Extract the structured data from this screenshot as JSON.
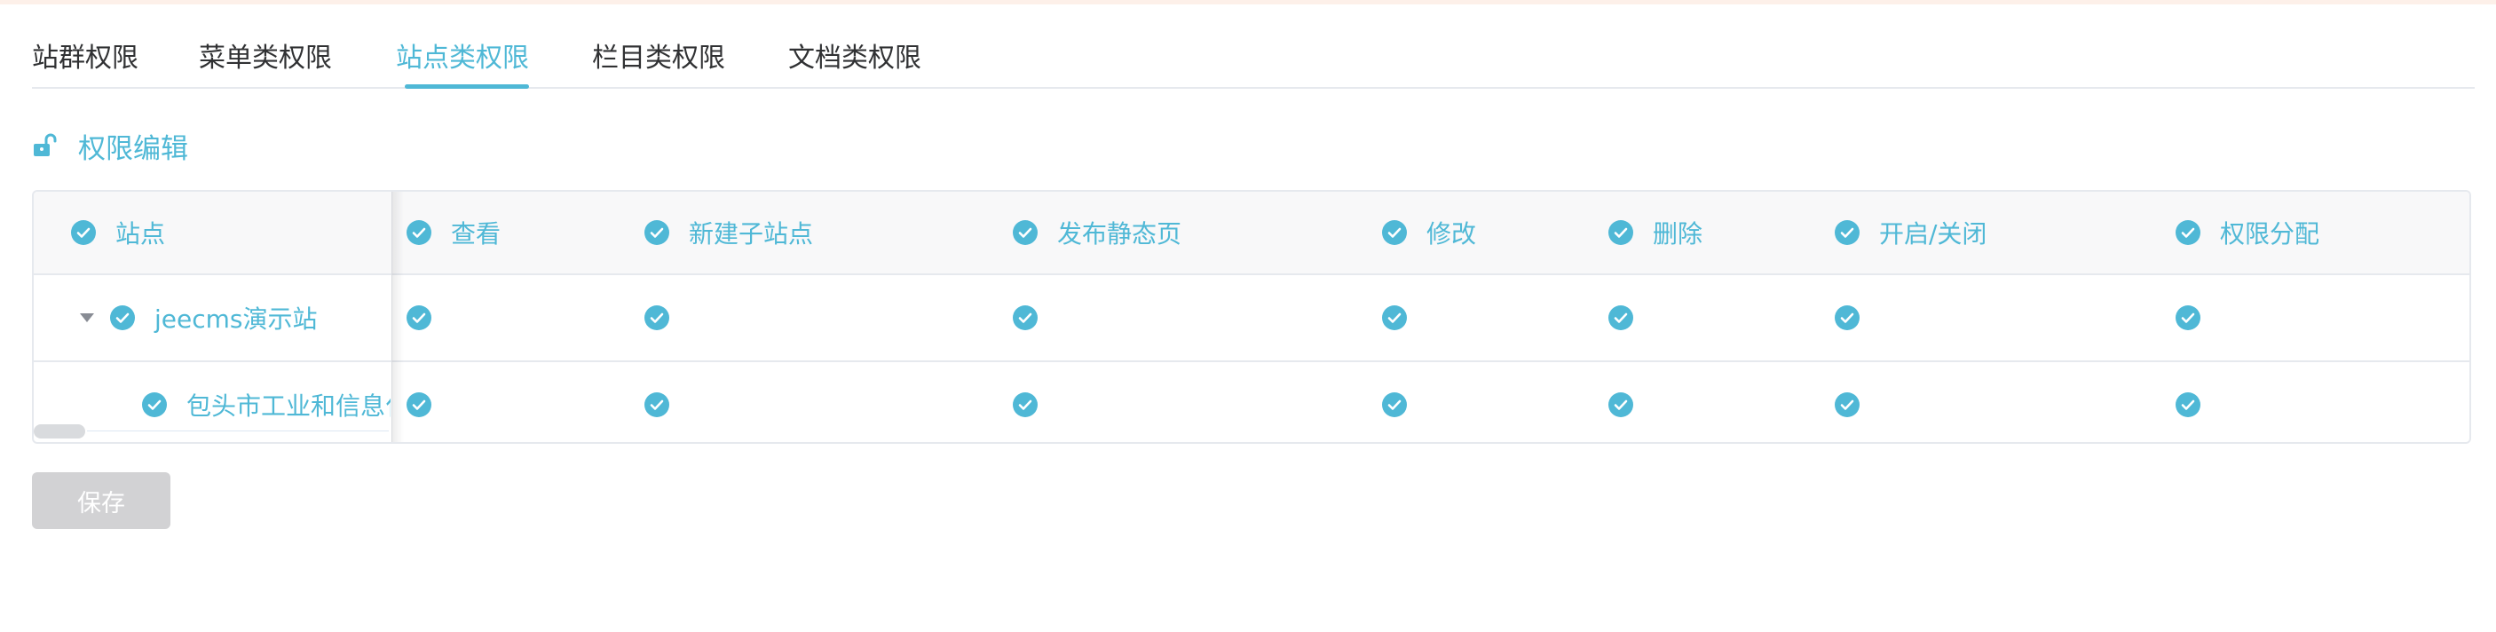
{
  "tabs": [
    {
      "label": "站群权限",
      "active": false
    },
    {
      "label": "菜单类权限",
      "active": false
    },
    {
      "label": "站点类权限",
      "active": true
    },
    {
      "label": "栏目类权限",
      "active": false
    },
    {
      "label": "文档类权限",
      "active": false
    }
  ],
  "section": {
    "title": "权限编辑",
    "icon": "unlock-icon"
  },
  "table": {
    "columns": [
      "站点",
      "查看",
      "新建子站点",
      "发布静态页",
      "修改",
      "删除",
      "开启/关闭",
      "权限分配"
    ],
    "rows": [
      {
        "name": "jeecms演示站",
        "expanded": true,
        "checked": [
          true,
          true,
          true,
          true,
          true,
          true,
          true,
          true
        ]
      },
      {
        "name": "包头市工业和信息化局",
        "checked": [
          true,
          true,
          true,
          true,
          true,
          true,
          true,
          true
        ]
      }
    ]
  },
  "save_button": {
    "label": "保存",
    "disabled": true
  },
  "colors": {
    "accent": "#4fb8d6",
    "text": "#303133",
    "header_bg": "#f8f8f9",
    "border": "#e6e9ee",
    "disabled_button": "#d2d2d4",
    "top_strip": "#fdf0e9"
  }
}
